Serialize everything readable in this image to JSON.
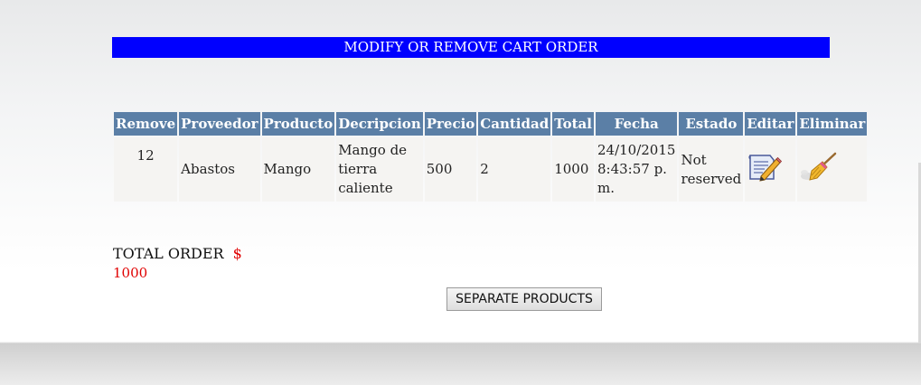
{
  "header": {
    "title": "MODIFY OR REMOVE CART ORDER"
  },
  "table": {
    "columns": [
      "Remove",
      "Proveedor",
      "Producto",
      "Decripcion",
      "Precio",
      "Cantidad",
      "Total",
      "Fecha",
      "Estado",
      "Editar",
      "Eliminar"
    ],
    "rows": [
      {
        "remove": "12",
        "proveedor": "Abastos",
        "producto": "Mango",
        "descripcion": "Mango de tierra caliente",
        "precio": "500",
        "cantidad": "2",
        "total": "1000",
        "fecha": "24/10/2015 8:43:57 p. m.",
        "estado": "Not reserved",
        "edit_icon": "edit-document-pencil-icon",
        "delete_icon": "broom-icon"
      }
    ]
  },
  "summary": {
    "total_label": "TOTAL ORDER",
    "currency": "$",
    "total_value": "1000"
  },
  "actions": {
    "separate_label": "SEPARATE PRODUCTS"
  },
  "colors": {
    "header_bar": "#0000ff",
    "table_header": "#5b7fa6",
    "row_bg": "#f5f4f2",
    "total_accent": "#e00000"
  }
}
